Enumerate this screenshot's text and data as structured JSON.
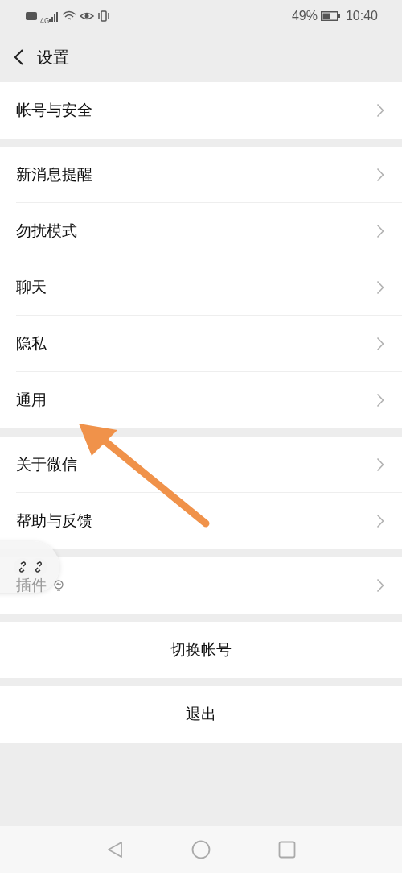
{
  "status_bar": {
    "network": "4G",
    "battery_percent": "49%",
    "time": "10:40"
  },
  "header": {
    "title": "设置"
  },
  "sections": [
    {
      "items": [
        {
          "label": "帐号与安全",
          "kind": "nav"
        }
      ]
    },
    {
      "items": [
        {
          "label": "新消息提醒",
          "kind": "nav"
        },
        {
          "label": "勿扰模式",
          "kind": "nav"
        },
        {
          "label": "聊天",
          "kind": "nav"
        },
        {
          "label": "隐私",
          "kind": "nav"
        },
        {
          "label": "通用",
          "kind": "nav"
        }
      ]
    },
    {
      "items": [
        {
          "label": "关于微信",
          "kind": "nav"
        },
        {
          "label": "帮助与反馈",
          "kind": "nav"
        }
      ]
    },
    {
      "items": [
        {
          "label": "插件",
          "kind": "plugin"
        }
      ]
    },
    {
      "items": [
        {
          "label": "切换帐号",
          "kind": "action"
        }
      ]
    },
    {
      "items": [
        {
          "label": "退出",
          "kind": "action"
        }
      ]
    }
  ]
}
